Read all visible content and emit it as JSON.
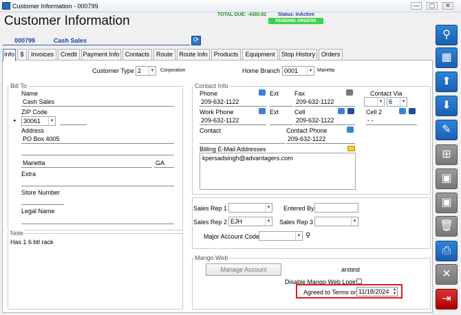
{
  "window": {
    "title": "Customer Information - 000799",
    "min": "—",
    "max": "▢",
    "close": "✕"
  },
  "header": {
    "total_due": "TOTAL DUE:   -4380.82",
    "status": "Status: InActive",
    "pending": "PENDING ORDERS",
    "title": "Customer Information",
    "customer_id": "000799",
    "customer_name": "Cash Sales"
  },
  "tabs": [
    "Info",
    "$",
    "Invoices",
    "Credit",
    "Payment Info",
    "Contacts",
    "Route",
    "Route Info",
    "Products",
    "Equipment",
    "Stop History",
    "Orders"
  ],
  "top": {
    "customer_type_label": "Customer Type",
    "customer_type_value": "2",
    "customer_type_desc": "Corporation",
    "home_branch_label": "Home Branch",
    "home_branch_value": "0001",
    "home_branch_desc": "Marietta"
  },
  "bill_to": {
    "title": "Bill To",
    "name_label": "Name",
    "name": "Cash Sales",
    "zip_label": "ZIP Code",
    "zip": "30061",
    "address_label": "Address",
    "address1": "PO Box 4005",
    "address2": "",
    "city": "Marietta",
    "state": "GA",
    "extra_label": "Extra",
    "store_label": "Store Number",
    "legal_label": "Legal Name"
  },
  "note": {
    "title": "Note",
    "text": "Has 1 6 btl rack"
  },
  "contact": {
    "title": "Contact Info",
    "phone_label": "Phone",
    "phone": "209-632-1122",
    "ext_label": "Ext",
    "fax_label": "Fax",
    "fax": "209-632-1122",
    "via_label": "Contact Via",
    "via_value": "6",
    "work_label": "Work Phone",
    "work": "209-632-1122",
    "ext2_label": "Ext",
    "cell_label": "Cell",
    "cell": "209-632-1122",
    "cell2_label": "Cell 2",
    "cell2": "-  -",
    "contact_label": "Contact",
    "contact_phone_label": "Contact Phone",
    "contact_phone": "209-632-1122",
    "billing_label": "Billing E-Mail Addresses",
    "billing_email": "kpersadsingh@advantagers.com"
  },
  "sales": {
    "rep1_label": "Sales Rep 1",
    "entered_label": "Entered By",
    "rep2_label": "Sales Rep 2",
    "rep2": "EJH",
    "rep3_label": "Sales Rep 3",
    "major_label": "Major Account Code"
  },
  "mango": {
    "title": "Mango Web",
    "manage_label": "Manage Account",
    "user": "arstest",
    "disable_label": "Disable Mango Web Login",
    "agreed_label": "Agreed to Terms on",
    "agreed_date": "11/18/2024"
  }
}
